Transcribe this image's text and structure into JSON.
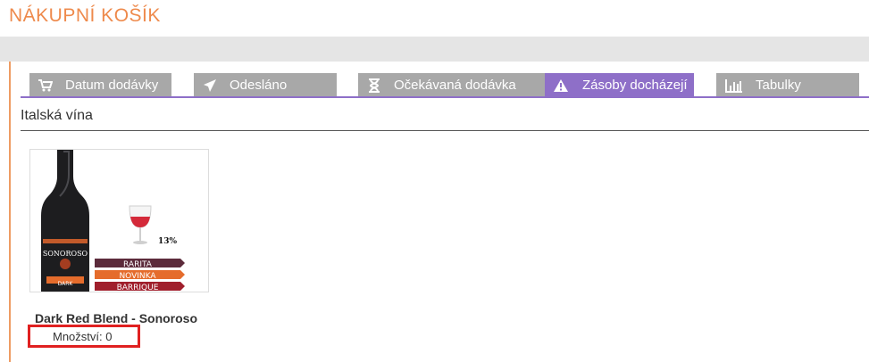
{
  "page": {
    "title": "NÁKUPNÍ KOŠÍK"
  },
  "tabs": [
    {
      "label": "Datum dodávky",
      "icon": "cart-icon",
      "active": false
    },
    {
      "label": "Odesláno",
      "icon": "paper-plane-icon",
      "active": false
    },
    {
      "label": "Očekávaná dodávka",
      "icon": "hourglass-icon",
      "active": false
    },
    {
      "label": "Zásoby docházejí",
      "icon": "warning-icon",
      "active": true
    },
    {
      "label": "Tabulky",
      "icon": "bar-chart-icon",
      "active": false
    }
  ],
  "section": {
    "title": "Italská vína"
  },
  "product": {
    "name": "Dark Red Blend - Sonoroso",
    "quantity_label": "Množství: 0",
    "image": {
      "bottle_brand": "SONOROSO",
      "bottle_sub": "DARK",
      "alcohol": "13%",
      "ribbons": [
        "RARITA",
        "NOVINKA",
        "BARRIQUE"
      ]
    }
  },
  "colors": {
    "accent_orange": "#ee8a4c",
    "tab_gray": "#a8a8a8",
    "tab_active": "#8e6fc8",
    "highlight_red": "#e02020"
  }
}
